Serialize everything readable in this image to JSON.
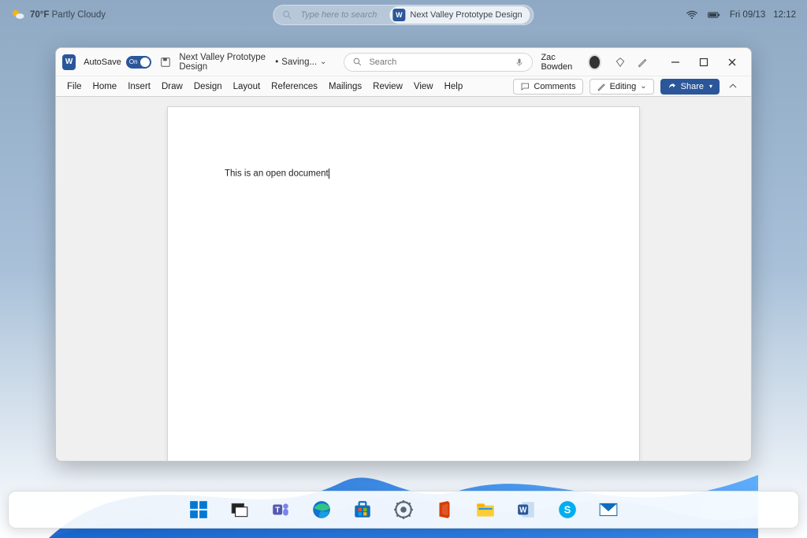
{
  "system": {
    "temperature": "70°F",
    "weather": "Partly Cloudy",
    "search_placeholder": "Type here to search",
    "search_result": "Next Valley Prototype Design",
    "date": "Fri 09/13",
    "time": "12:12"
  },
  "window": {
    "autosave_label": "AutoSave",
    "autosave_on": "On",
    "doc_title": "Next Valley Prototype Design",
    "save_state": "Saving...",
    "search_placeholder": "Search",
    "user_name": "Zac Bowden",
    "comments_label": "Comments",
    "editing_label": "Editing",
    "share_label": "Share",
    "tabs": [
      "File",
      "Home",
      "Insert",
      "Draw",
      "Design",
      "Layout",
      "References",
      "Mailings",
      "Review",
      "View",
      "Help"
    ]
  },
  "document": {
    "body_text": "This is an open document"
  },
  "taskbar": {
    "items": [
      "start",
      "task-view",
      "teams",
      "edge",
      "store",
      "settings",
      "office",
      "files",
      "word",
      "skype",
      "mail"
    ]
  }
}
